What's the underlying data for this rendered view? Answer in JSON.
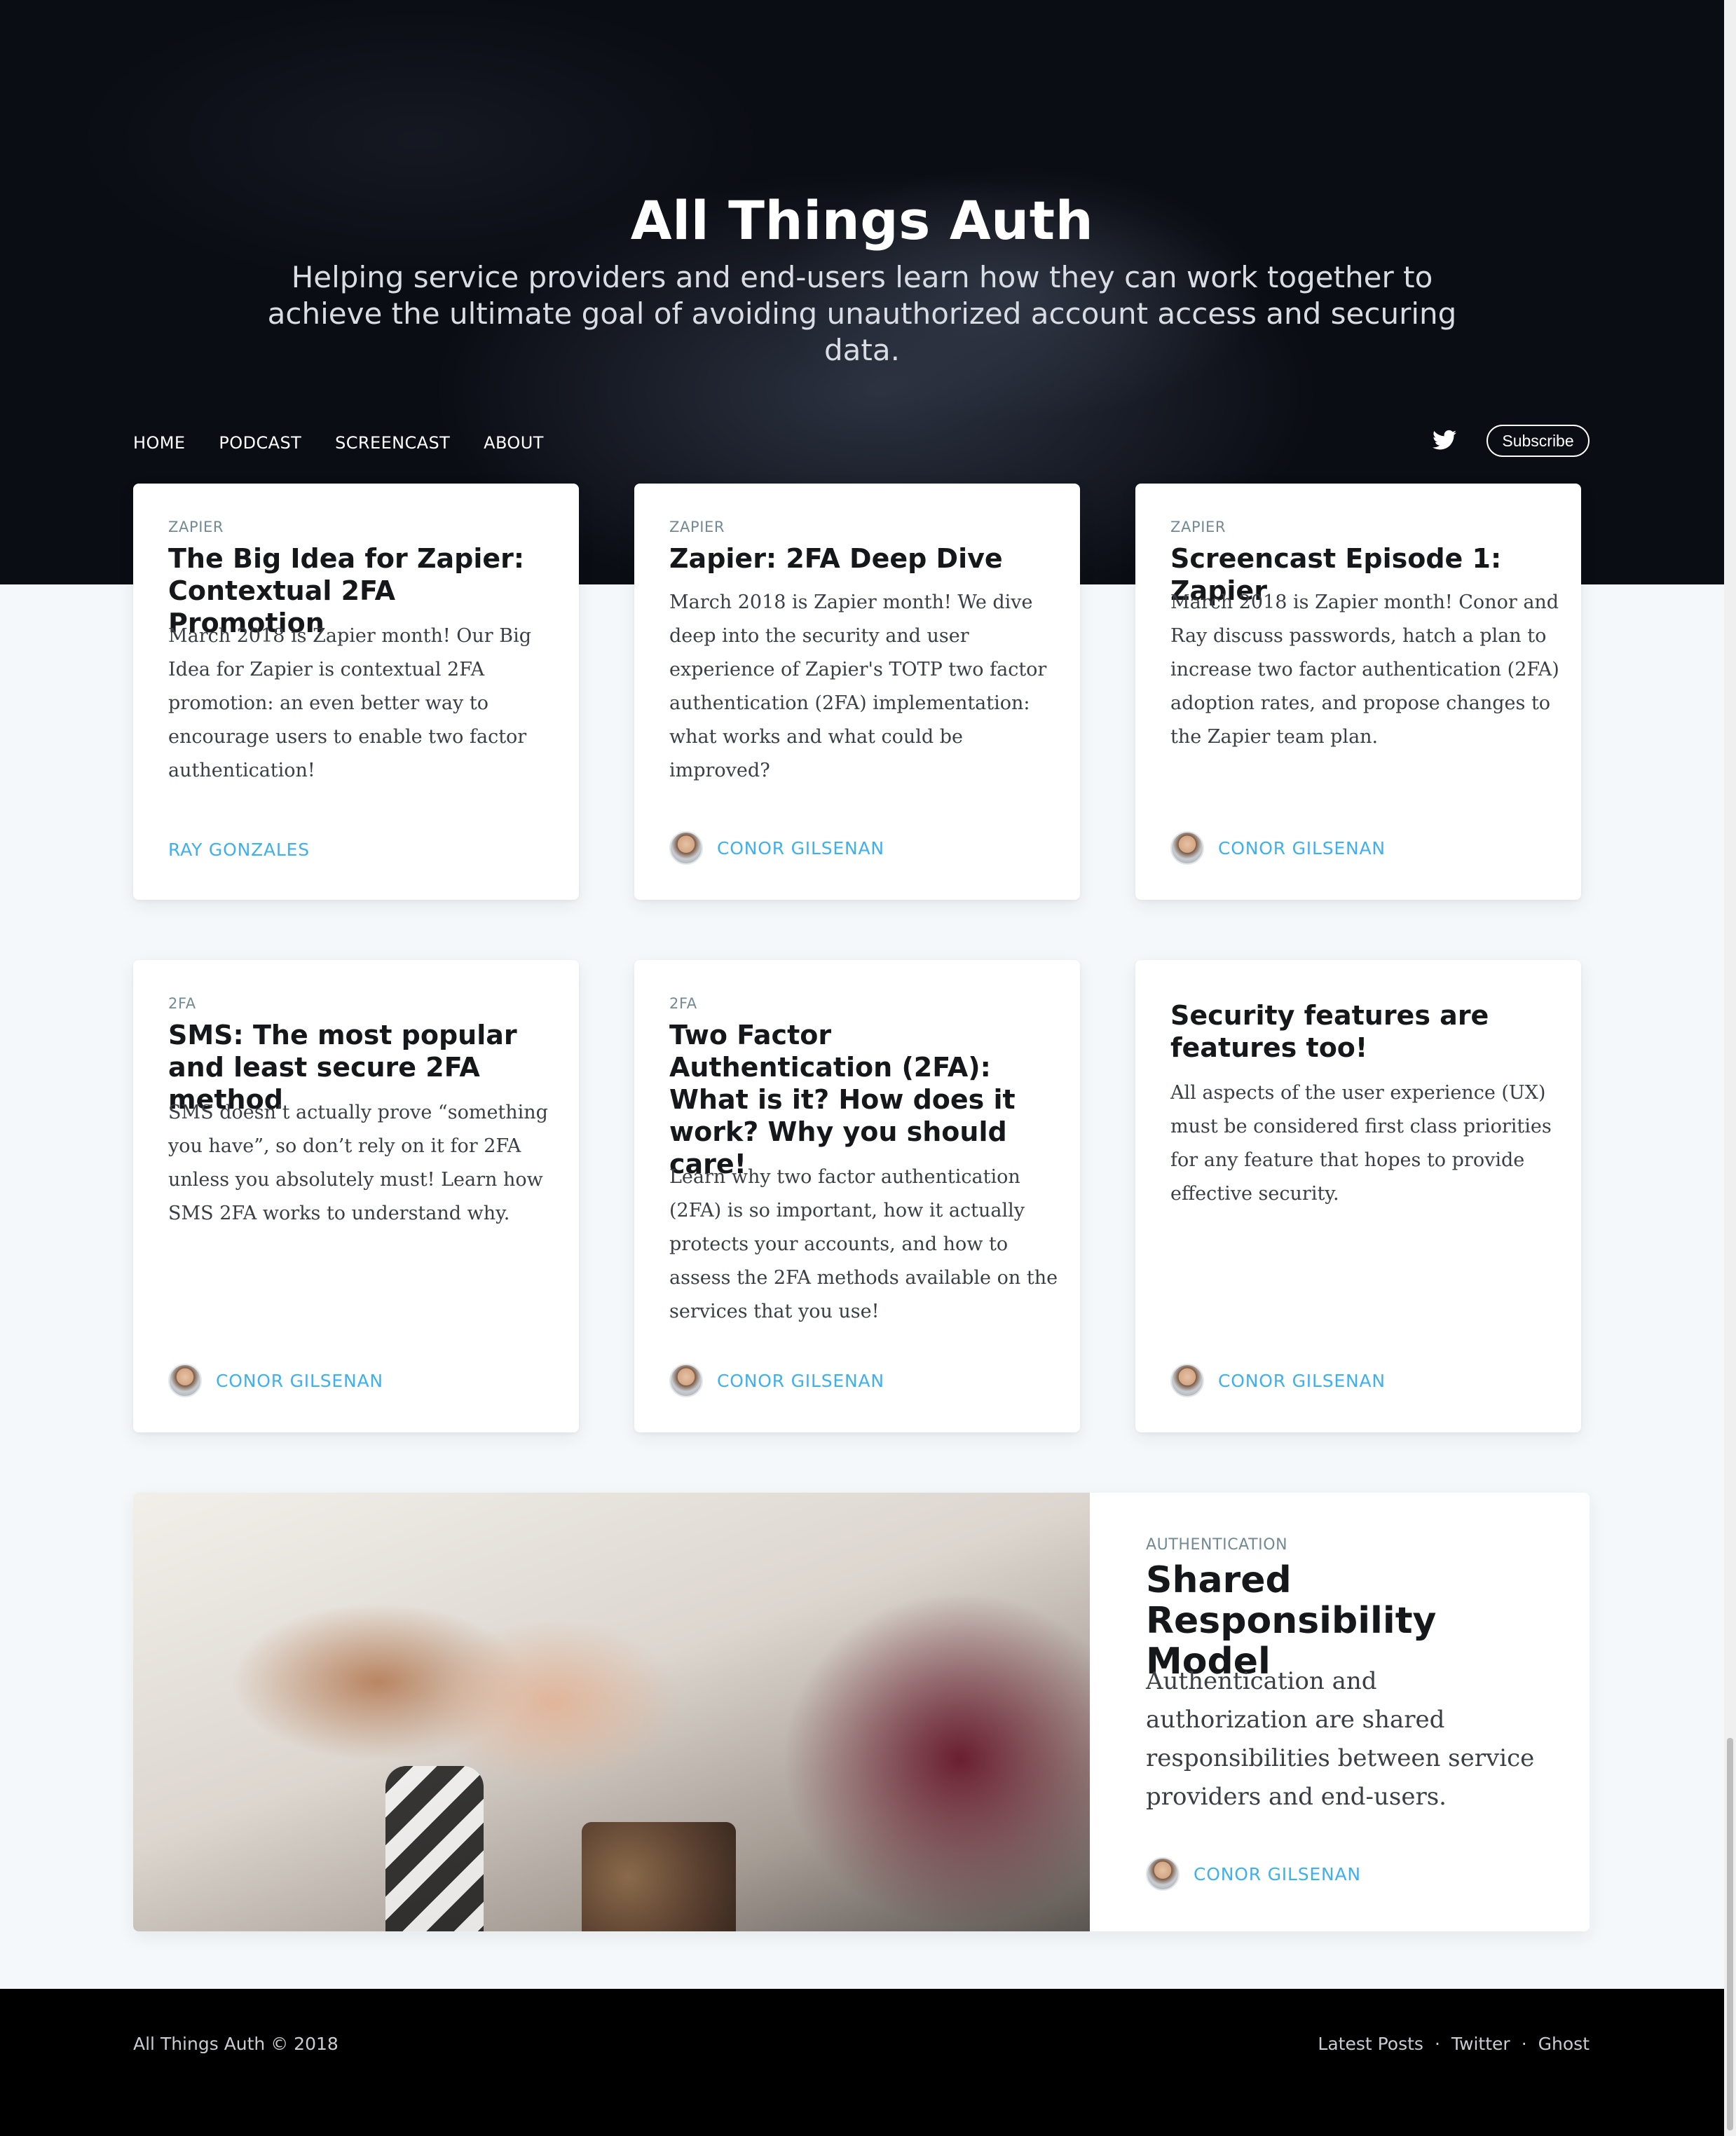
{
  "site": {
    "title": "All Things Auth",
    "description": "Helping service providers and end-users learn how they can work together to achieve the ultimate goal of avoiding unauthorized account access and securing data."
  },
  "nav": {
    "items": [
      "HOME",
      "PODCAST",
      "SCREENCAST",
      "ABOUT"
    ],
    "subscribe_label": "Subscribe",
    "social_icon": "twitter-icon"
  },
  "posts": [
    {
      "tag": "ZAPIER",
      "title": "The Big Idea for Zapier: Contextual 2FA Promotion",
      "excerpt": "March 2018 is Zapier month! Our Big Idea for Zapier is contextual 2FA promotion: an even better way to encourage users to enable two factor authentication!",
      "author": "RAY GONZALES"
    },
    {
      "tag": "ZAPIER",
      "title": "Zapier: 2FA Deep Dive",
      "excerpt": "March 2018 is Zapier month! We dive deep into the security and user experience of Zapier's TOTP two factor authentication (2FA) implementation: what works and what could be improved?",
      "author": "CONOR GILSENAN"
    },
    {
      "tag": "ZAPIER",
      "title": "Screencast Episode 1: Zapier",
      "excerpt": "March 2018 is Zapier month! Conor and Ray discuss passwords, hatch a plan to increase two factor authentication (2FA) adoption rates, and propose changes to the Zapier team plan.",
      "author": "CONOR GILSENAN"
    },
    {
      "tag": "2FA",
      "title": "SMS: The most popular and least secure 2FA method",
      "excerpt": "SMS doesn’t actually prove “something you have”, so don’t rely on it for 2FA unless you absolutely must! Learn how SMS 2FA works to understand why.",
      "author": "CONOR GILSENAN"
    },
    {
      "tag": "2FA",
      "title": "Two Factor Authentication (2FA): What is it? How does it work? Why you should care!",
      "excerpt": "Learn why two factor authentication (2FA) is so important, how it actually protects your accounts, and how to assess the 2FA methods available on the services that you use!",
      "author": "CONOR GILSENAN"
    },
    {
      "tag": "",
      "title": "Security features are features too!",
      "excerpt": "All aspects of the user experience (UX) must be considered first class priorities for any feature that hopes to provide effective security.",
      "author": "CONOR GILSENAN"
    }
  ],
  "feature": {
    "tag": "AUTHENTICATION",
    "title": "Shared Responsibility Model",
    "excerpt": "Authentication and authorization are shared responsibilities between service providers and end-users.",
    "author": "CONOR GILSENAN"
  },
  "footer": {
    "copyright": "All Things Auth © 2018",
    "links": [
      "Latest Posts",
      "Twitter",
      "Ghost"
    ],
    "separator": "·"
  },
  "colors": {
    "accent": "#3eb0ef",
    "tag": "#738a94",
    "hero_bg": "#0b0d14",
    "footer_bg": "#000000"
  }
}
